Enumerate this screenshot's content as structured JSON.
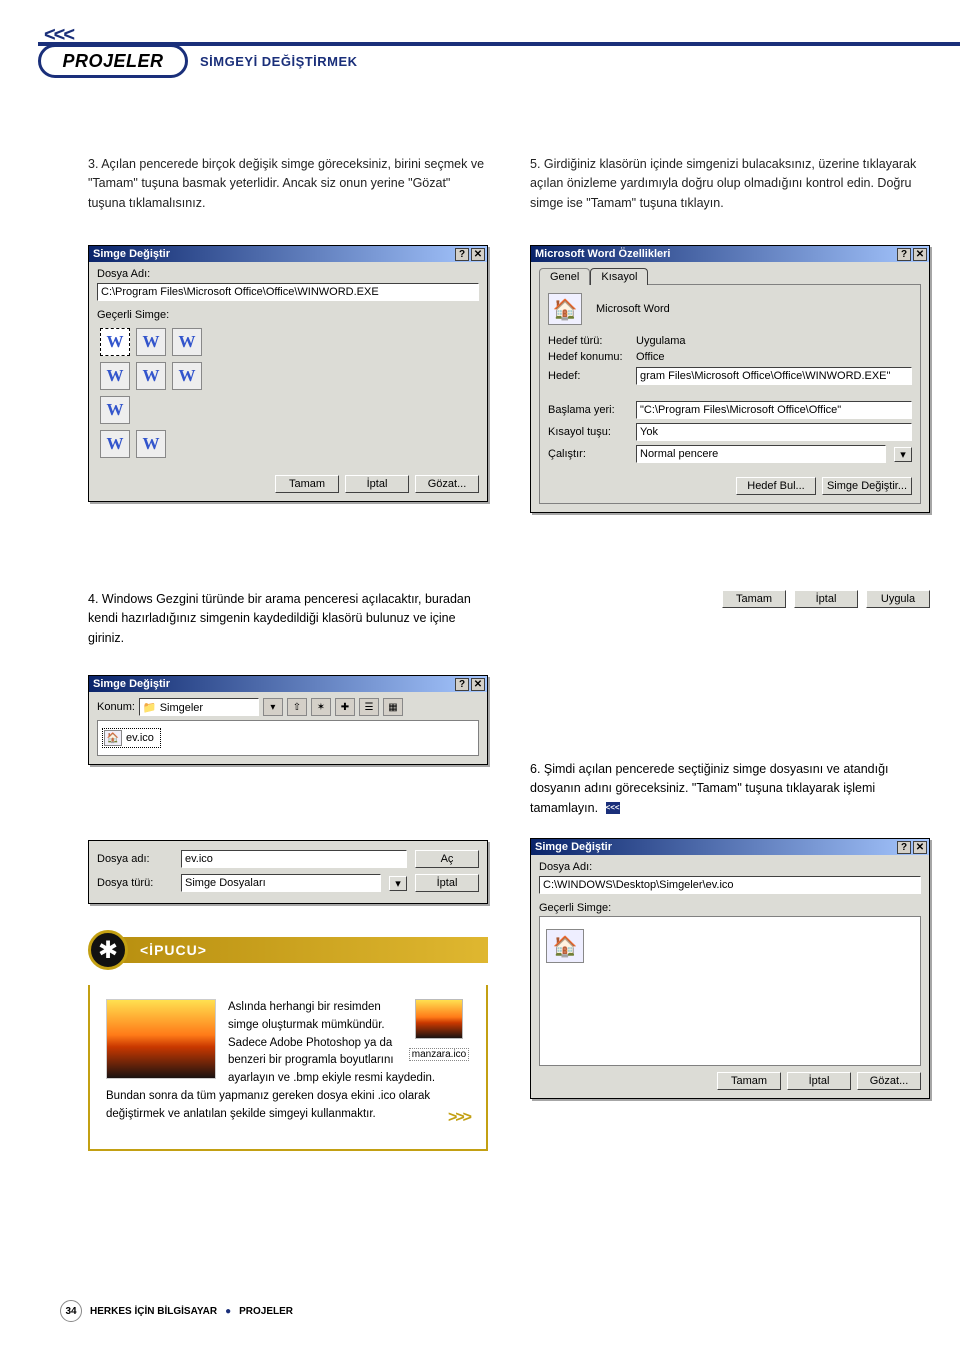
{
  "header": {
    "chevrons": "<<<",
    "section": "PROJELER",
    "title": "SİMGEYİ DEĞİŞTİRMEK"
  },
  "steps": {
    "p3": "3. Açılan pencerede birçok değişik simge göreceksiniz, birini seçmek ve \"Tamam\" tuşuna basmak yeterlidir. Ancak siz onun yerine \"Gözat\" tuşuna tıklamalısınız.",
    "p4": "4. Windows Gezgini türünde bir arama penceresi açılacaktır, buradan kendi hazırladığınız simgenin kaydedildiği klasörü bulunuz ve içine giriniz.",
    "p5": "5. Girdiğiniz klasörün içinde simgenizi bulacaksınız, üzerine tıklayarak açılan önizleme yardımıyla doğru olup olmadığını kontrol edin. Doğru simge ise \"Tamam\" tuşuna tıklayın.",
    "p6": "6. Şimdi açılan pencerede seçtiğiniz simge dosyasını ve atandığı dosyanın adını göreceksiniz. \"Tamam\" tuşuna tıklayarak işlemi tamamlayın."
  },
  "dlg1": {
    "title": "Simge Değiştir",
    "lbl_dosya": "Dosya Adı:",
    "path": "C:\\Program Files\\Microsoft Office\\Office\\WINWORD.EXE",
    "lbl_gecerli": "Geçerli Simge:",
    "btn_tamam": "Tamam",
    "btn_iptal": "İptal",
    "btn_gozat": "Gözat..."
  },
  "dlg5": {
    "title": "Microsoft Word Özellikleri",
    "tab1": "Genel",
    "tab2": "Kısayol",
    "app": "Microsoft Word",
    "lbl_hedef_turu": "Hedef türü:",
    "val_hedef_turu": "Uygulama",
    "lbl_hedef_konumu": "Hedef konumu:",
    "val_hedef_konumu": "Office",
    "lbl_hedef": "Hedef:",
    "val_hedef": "gram Files\\Microsoft Office\\Office\\WINWORD.EXE\"",
    "lbl_baslama": "Başlama yeri:",
    "val_baslama": "\"C:\\Program Files\\Microsoft Office\\Office\"",
    "lbl_kisayol": "Kısayol tuşu:",
    "val_kisayol": "Yok",
    "lbl_calistir": "Çalıştır:",
    "val_calistir": "Normal pencere",
    "btn_hedef_bul": "Hedef Bul...",
    "btn_simge": "Simge Değiştir...",
    "btn_tamam": "Tamam",
    "btn_iptal": "İptal",
    "btn_uygula": "Uygula"
  },
  "dlg4": {
    "title": "Simge Değiştir",
    "lbl_konum": "Konum:",
    "folder": "Simgeler",
    "file": "ev.ico",
    "lbl_dosya_adi": "Dosya adı:",
    "val_dosya_adi": "ev.ico",
    "lbl_dosya_turu": "Dosya türü:",
    "val_dosya_turu": "Simge Dosyaları",
    "btn_ac": "Aç",
    "btn_iptal": "İptal"
  },
  "dlg6": {
    "title": "Simge Değiştir",
    "lbl_dosya": "Dosya Adı:",
    "path": "C:\\WINDOWS\\Desktop\\Simgeler\\ev.ico",
    "lbl_gecerli": "Geçerli Simge:",
    "btn_tamam": "Tamam",
    "btn_iptal": "İptal",
    "btn_gozat": "Gözat..."
  },
  "ipucu": {
    "heading": "<İPUCU>",
    "caption": "manzara.ico",
    "text": "Aslında herhangi bir resimden simge oluşturmak mümkündür. Sadece Adobe Photoshop ya da benzeri bir programla boyutlarını ayarlayın ve .bmp ekiyle resmi kaydedin. Bundan sonra da tüm yapmanız gereken dosya ekini .ico olarak değiştirmek ve anlatılan şekilde simgeyi kullanmaktır.",
    "more": ">>>"
  },
  "footer": {
    "page": "34",
    "text1": "HERKES İÇİN BİLGİSAYAR",
    "text2": "PROJELER"
  },
  "endmark": "<<<"
}
